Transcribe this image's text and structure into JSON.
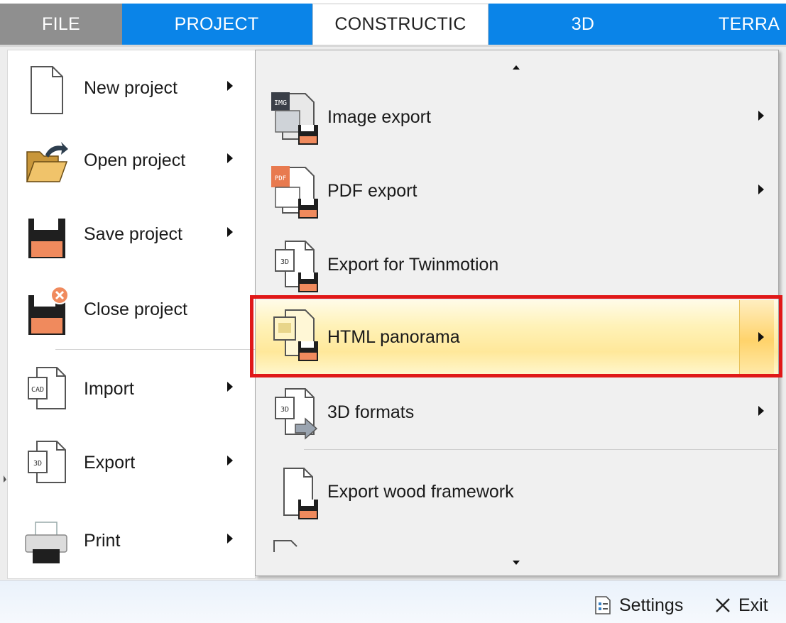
{
  "ribbon": {
    "tabs": [
      {
        "label": "FILE"
      },
      {
        "label": "PROJECT"
      },
      {
        "label": "CONSTRUCTIC"
      },
      {
        "label": "3D"
      },
      {
        "label": "TERRA"
      }
    ]
  },
  "file_menu": {
    "items": [
      {
        "label": "New project",
        "icon": "blank-document-icon",
        "has_submenu": true
      },
      {
        "label": "Open project",
        "icon": "open-folder-icon",
        "has_submenu": true
      },
      {
        "label": "Save project",
        "icon": "floppy-disk-icon",
        "has_submenu": true
      },
      {
        "label": "Close project",
        "icon": "close-project-icon",
        "has_submenu": false
      },
      {
        "label": "Import",
        "icon": "import-cad-icon",
        "has_submenu": true
      },
      {
        "label": "Export",
        "icon": "export-3d-icon",
        "has_submenu": true
      },
      {
        "label": "Print",
        "icon": "printer-icon",
        "has_submenu": true
      }
    ]
  },
  "export_submenu": {
    "items": [
      {
        "label": "Image export",
        "icon": "image-export-icon",
        "icon_tag": "IMG",
        "has_submenu": true
      },
      {
        "label": "PDF export",
        "icon": "pdf-export-icon",
        "icon_tag": "PDF",
        "has_submenu": true
      },
      {
        "label": "Export for Twinmotion",
        "icon": "twinmotion-export-icon",
        "icon_tag": "3D",
        "has_submenu": false
      },
      {
        "label": "HTML panorama",
        "icon": "html-panorama-icon",
        "has_submenu": true,
        "highlighted": true
      },
      {
        "label": "3D formats",
        "icon": "3d-formats-icon",
        "icon_tag": "3D",
        "has_submenu": true
      },
      {
        "label": "Export wood framework",
        "icon": "wood-framework-icon",
        "has_submenu": false
      }
    ]
  },
  "import_icon_tag": "CAD",
  "export_icon_tag": "3D",
  "footer": {
    "settings_label": "Settings",
    "exit_label": "Exit"
  },
  "colors": {
    "ribbon_blue": "#0a84e8",
    "file_tab_gray": "#8f8f8f",
    "highlight_yellow": "#ffe89a",
    "annotation_red": "#e01818",
    "save_orange": "#f08a5d"
  }
}
